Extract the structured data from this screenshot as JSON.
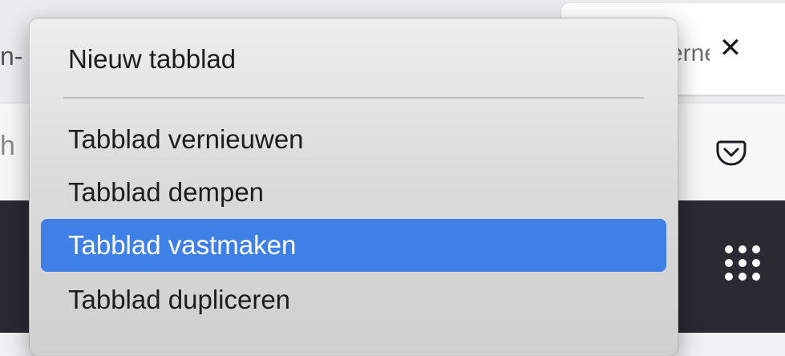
{
  "background": {
    "left_tab_fragment": "n-",
    "active_tab": {
      "title_fragment": "erne",
      "close_glyph": "✕"
    },
    "toolbar_fragment": "h",
    "icons": [
      "pocket-icon",
      "apps-grid-icon"
    ]
  },
  "context_menu": {
    "items": [
      {
        "label": "Nieuw tabblad"
      },
      {
        "label": "Tabblad vernieuwen"
      },
      {
        "label": "Tabblad dempen"
      },
      {
        "label": "Tabblad vastmaken",
        "highlighted": true
      },
      {
        "label": "Tabblad dupliceren"
      }
    ]
  },
  "colors": {
    "highlight": "#3f80e6",
    "menu_text": "#1d1d1f",
    "dark_toolbar": "#2b2a33"
  }
}
